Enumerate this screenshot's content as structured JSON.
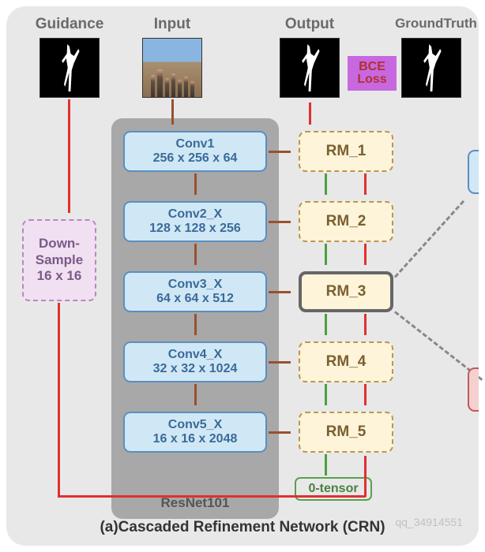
{
  "labels": {
    "guidance": "Guidance",
    "input": "Input",
    "output": "Output",
    "groundtruth": "GroundTruth"
  },
  "resnet": {
    "label": "ResNet101",
    "layers": [
      {
        "name": "Conv1",
        "dims": "256 x 256 x 64"
      },
      {
        "name": "Conv2_X",
        "dims": "128 x 128 x 256"
      },
      {
        "name": "Conv3_X",
        "dims": "64 x 64 x 512"
      },
      {
        "name": "Conv4_X",
        "dims": "32 x 32 x 1024"
      },
      {
        "name": "Conv5_X",
        "dims": "16 x 16 x 2048"
      }
    ]
  },
  "rm": [
    "RM_1",
    "RM_2",
    "RM_3",
    "RM_4",
    "RM_5"
  ],
  "downsample": {
    "line1": "Down-",
    "line2": "Sample",
    "line3": "16 x 16"
  },
  "bce": {
    "line1": "BCE",
    "line2": "Loss"
  },
  "zero": "0-tensor",
  "caption": "(a)Cascaded Refinement Network (CRN)",
  "watermark": "qq_34914551"
}
